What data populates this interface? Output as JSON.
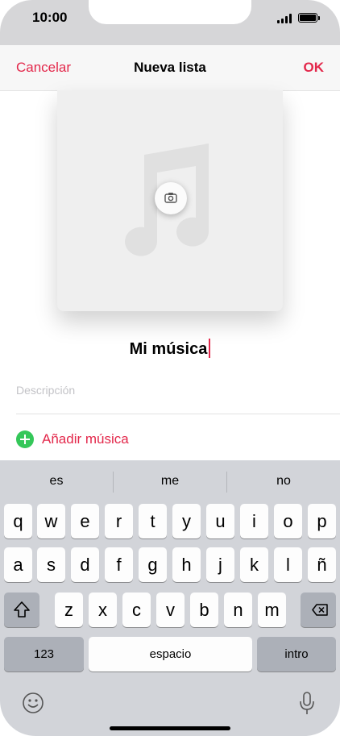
{
  "status": {
    "time": "10:00"
  },
  "nav": {
    "cancel": "Cancelar",
    "title": "Nueva lista",
    "ok": "OK"
  },
  "playlist": {
    "name": "Mi música",
    "description_placeholder": "Descripción",
    "add_music": "Añadir música"
  },
  "keyboard": {
    "suggestions": [
      "es",
      "me",
      "no"
    ],
    "row1": [
      "q",
      "w",
      "e",
      "r",
      "t",
      "y",
      "u",
      "i",
      "o",
      "p"
    ],
    "row2": [
      "a",
      "s",
      "d",
      "f",
      "g",
      "h",
      "j",
      "k",
      "l",
      "ñ"
    ],
    "row3": [
      "z",
      "x",
      "c",
      "v",
      "b",
      "n",
      "m"
    ],
    "numbers_key": "123",
    "space_key": "espacio",
    "return_key": "intro"
  },
  "colors": {
    "accent": "#e3284b",
    "add_icon": "#34c759",
    "keyboard_bg": "#d2d4d9"
  },
  "icons": [
    "signal-icon",
    "battery-icon",
    "music-note-icon",
    "camera-icon",
    "add-icon",
    "shift-icon",
    "delete-icon",
    "emoji-icon",
    "microphone-icon"
  ]
}
